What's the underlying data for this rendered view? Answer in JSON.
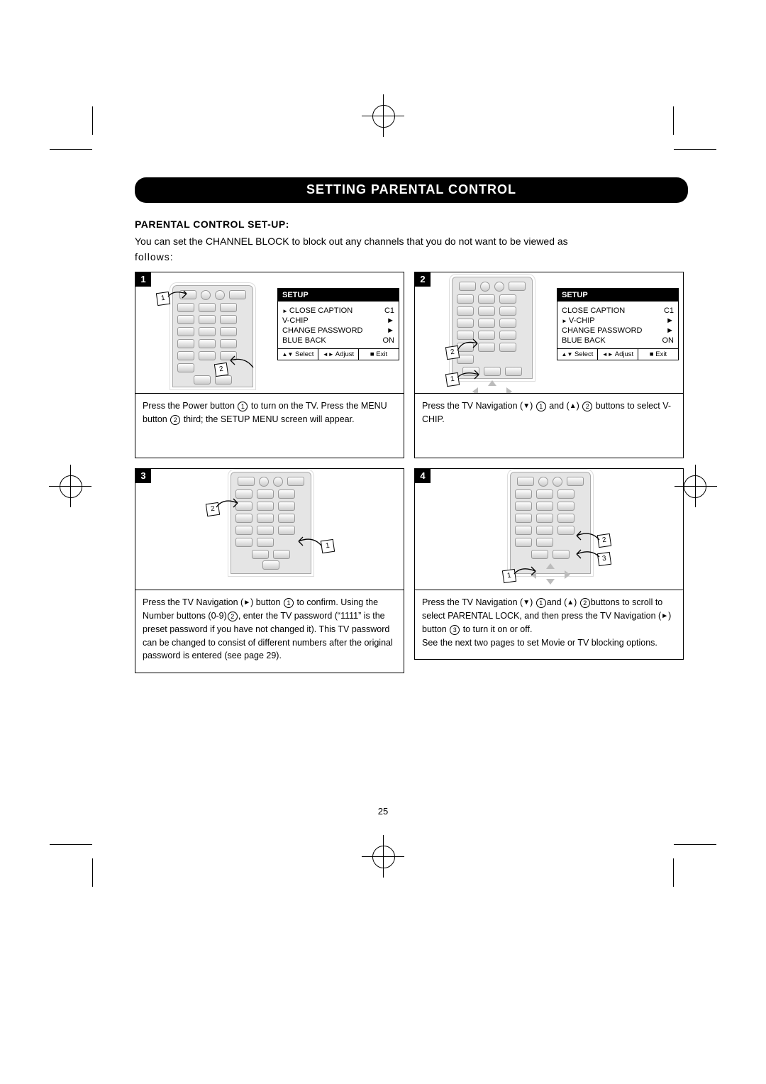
{
  "header": {
    "title": "SETTING PARENTAL CONTROL"
  },
  "section": {
    "heading": "PARENTAL CONTROL SET-UP:",
    "intro_line1": "You can set the CHANNEL BLOCK to block out any channels that you do not want to be viewed as",
    "intro_line2": "follows:"
  },
  "osd": {
    "title": "SETUP",
    "items": [
      {
        "label": "CLOSE CAPTION",
        "value": "C1"
      },
      {
        "label": "V-CHIP",
        "value": "►"
      },
      {
        "label": "CHANGE PASSWORD",
        "value": "►"
      },
      {
        "label": "BLUE BACK",
        "value": "ON"
      }
    ],
    "footer": {
      "select": "Select",
      "adjust": "Adjust",
      "exit": "Exit"
    }
  },
  "steps": {
    "s1": {
      "num": "1",
      "caption_a": "Press the Power button ",
      "caption_b": " to turn on the TV. Press the MENU button ",
      "caption_c": " third; the SETUP MENU screen will appear."
    },
    "s2": {
      "num": "2",
      "caption_a": "Press the TV Navigation (",
      "caption_b": ") ",
      "caption_c": " and (",
      "caption_d": ") ",
      "caption_e": " buttons to select V-CHIP."
    },
    "s3": {
      "num": "3",
      "caption_a": "Press the TV Navigation (",
      "caption_b": ") button ",
      "caption_c": " to confirm. Using the Number buttons (0-9)",
      "caption_d": ", enter the TV password (“1111” is the preset password if you have not changed it). This TV password can be changed to consist of different numbers after the original password is entered (see page 29)."
    },
    "s4": {
      "num": "4",
      "caption_a": "Press the TV Navigation (",
      "caption_b": ") ",
      "caption_c": "and (",
      "caption_d": ") ",
      "caption_e": "buttons to scroll to select PARENTAL LOCK, and then press the TV Navigation (",
      "caption_f": ") button ",
      "caption_g": " to turn it on or off.",
      "caption_h": "See the next two pages to set Movie or TV blocking options."
    }
  },
  "page_number": "25"
}
